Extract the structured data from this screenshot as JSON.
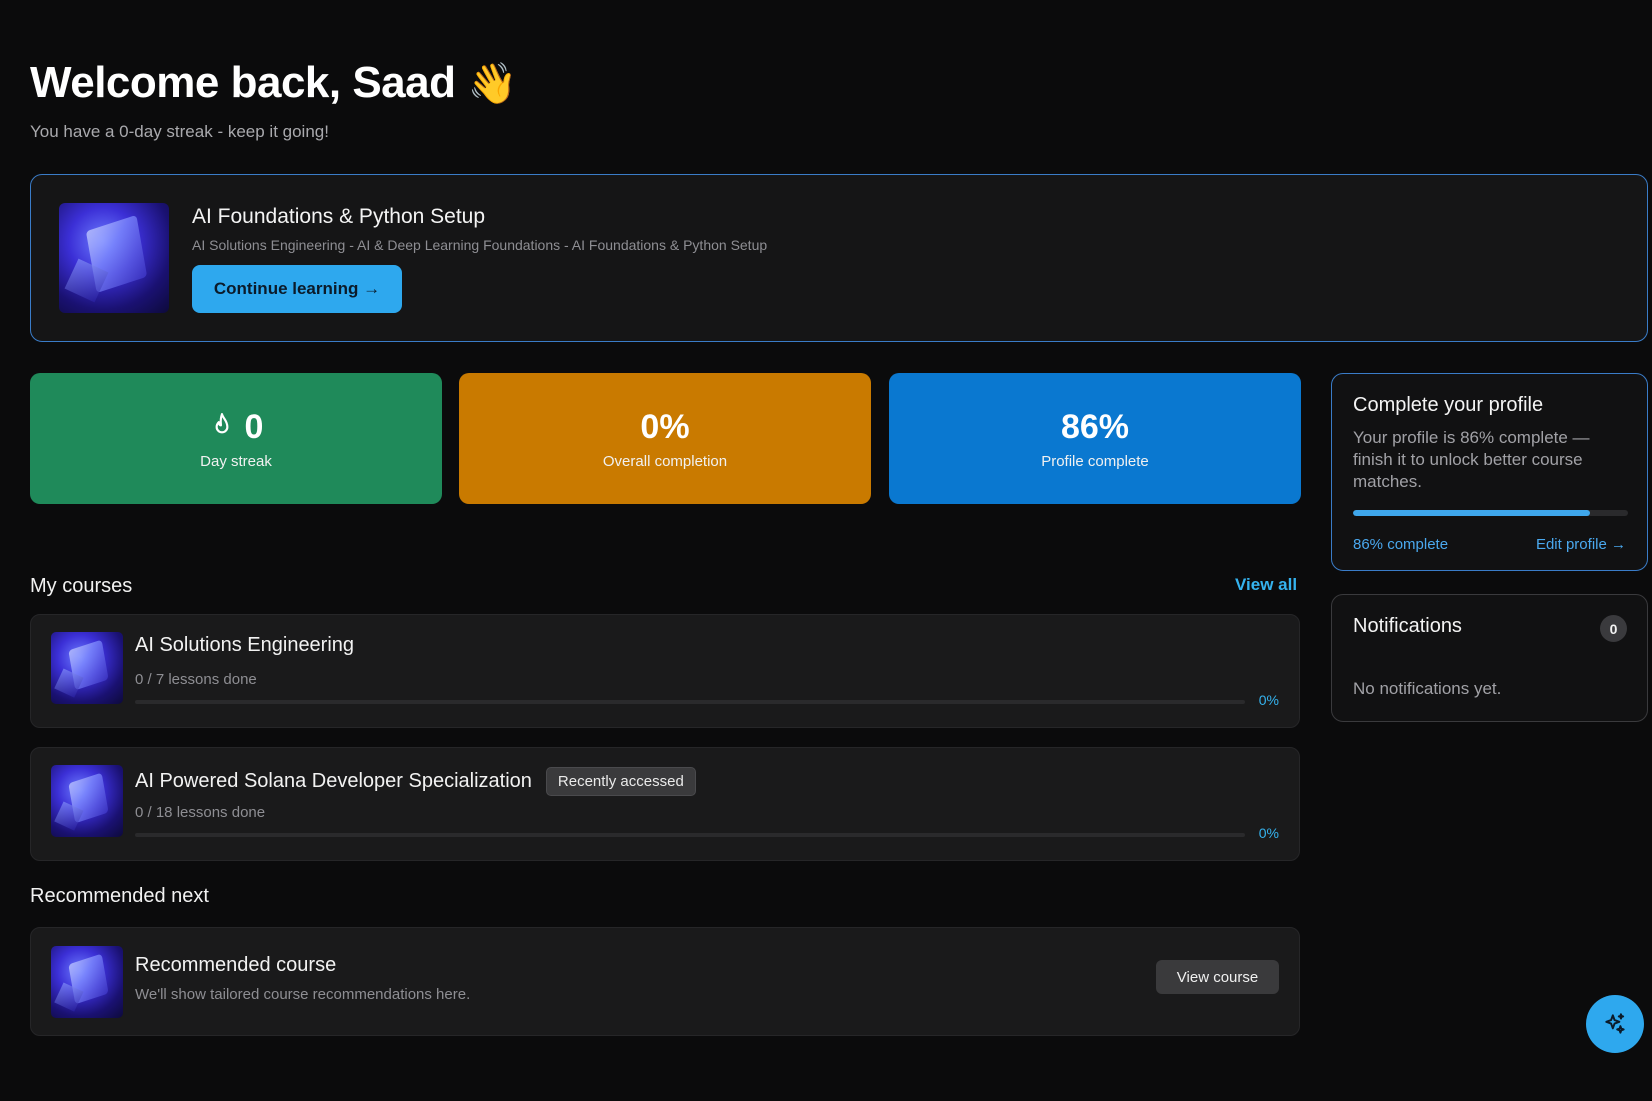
{
  "header": {
    "title": "Welcome back, Saad",
    "emoji": "👋",
    "subtitle": "You have a 0-day streak - keep it going!"
  },
  "continue_card": {
    "title": "AI Foundations & Python Setup",
    "path": "AI Solutions Engineering - AI & Deep Learning Foundations - AI Foundations & Python Setup",
    "button_label": "Continue learning →"
  },
  "stats": [
    {
      "value": "0",
      "label": "Day streak",
      "icon": "flame-icon",
      "color": "#1f8a5a"
    },
    {
      "value": "0%",
      "label": "Overall completion",
      "color": "#c97a00"
    },
    {
      "value": "86%",
      "label": "Profile complete",
      "color": "#0a78d0"
    }
  ],
  "profile": {
    "title": "Complete your profile",
    "description": "Your profile is 86% complete — finish it to unlock better course matches.",
    "progress": 0.86,
    "progress_label": "86% complete",
    "edit_label": "Edit profile →"
  },
  "notifications": {
    "title": "Notifications",
    "count": "0",
    "empty_text": "No notifications yet."
  },
  "my_courses": {
    "title": "My courses",
    "view_all": "View all",
    "items": [
      {
        "title": "AI Solutions Engineering",
        "lessons": "0 / 7 lessons done",
        "percent": "0%",
        "progress": 0,
        "badge": ""
      },
      {
        "title": "AI Powered Solana Developer Specialization",
        "lessons": "0 / 18 lessons done",
        "percent": "0%",
        "progress": 0,
        "badge": "Recently accessed"
      }
    ]
  },
  "recommended": {
    "title": "Recommended next",
    "card_title": "Recommended course",
    "card_subtitle": "We'll show tailored course recommendations here.",
    "button_label": "View course"
  },
  "fab": {
    "icon": "sparkle-icon"
  },
  "colors": {
    "accent": "#2ea8ee",
    "link": "#35b3ef",
    "background": "#0b0b0c"
  }
}
